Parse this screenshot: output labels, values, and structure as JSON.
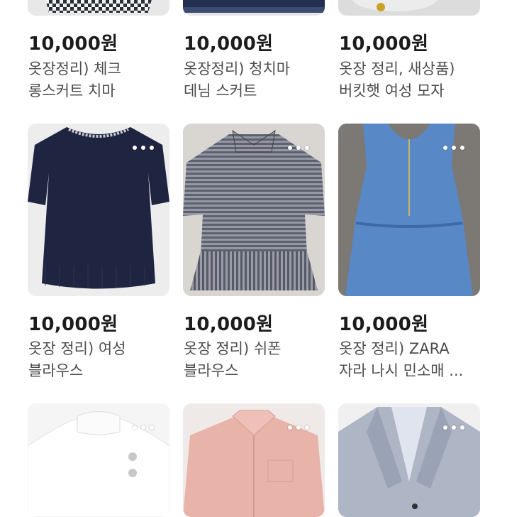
{
  "listings": [
    {
      "price": "10,000원",
      "title_line1": "옷장정리) 체크",
      "title_line2": "롱스커트 치마",
      "thumb_icon": "check-skirt-photo"
    },
    {
      "price": "10,000원",
      "title_line1": "옷장정리) 청치마",
      "title_line2": "데님 스커트",
      "thumb_icon": "denim-skirt-photo"
    },
    {
      "price": "10,000원",
      "title_line1": "옷장 정리, 새상품)",
      "title_line2": "버킷햇 여성 모자",
      "thumb_icon": "bucket-hat-photo"
    },
    {
      "price": "10,000원",
      "title_line1": "옷장 정리) 여성",
      "title_line2": "블라우스",
      "thumb_icon": "navy-blouse-photo"
    },
    {
      "price": "10,000원",
      "title_line1": "옷장 정리) 쉬폰",
      "title_line2": "블라우스",
      "thumb_icon": "striped-chiffon-blouse-photo"
    },
    {
      "price": "10,000원",
      "title_line1": "옷장 정리) ZARA",
      "title_line2": "자라 나시 민소매 ...",
      "thumb_icon": "denim-romper-photo"
    },
    {
      "price": "",
      "title_line1": "",
      "title_line2": "",
      "thumb_icon": "white-knit-photo"
    },
    {
      "price": "",
      "title_line1": "",
      "title_line2": "",
      "thumb_icon": "pink-shirt-photo"
    },
    {
      "price": "",
      "title_line1": "",
      "title_line2": "",
      "thumb_icon": "grey-blazer-photo"
    }
  ],
  "colors": {
    "price": "#1c1c1c",
    "title": "#4d4d4d"
  }
}
